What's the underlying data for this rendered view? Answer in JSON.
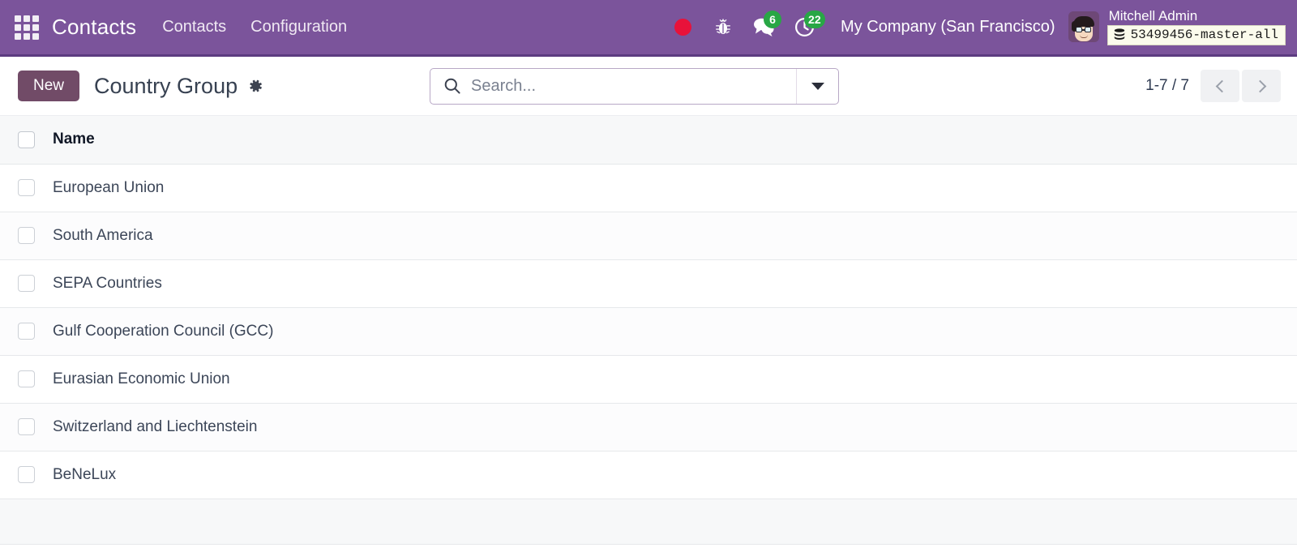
{
  "navbar": {
    "apps_icon": "apps-grid-icon",
    "brand": "Contacts",
    "menu_items": [
      {
        "label": "Contacts"
      },
      {
        "label": "Configuration"
      }
    ],
    "recording_indicator": "record-dot-icon",
    "debug_icon": "bug-icon",
    "messages": {
      "icon": "chat-icon",
      "count": "6"
    },
    "activities": {
      "icon": "clock-icon",
      "count": "22"
    },
    "company": "My Company (San Francisco)",
    "user": {
      "avatar": "user-avatar",
      "name": "Mitchell Admin",
      "database": "53499456-master-all",
      "database_icon": "database-icon"
    },
    "colors": {
      "background": "#7b549b",
      "border": "#5c3b80",
      "badge_green": "#28a745",
      "record_red": "#e8123a"
    }
  },
  "control_panel": {
    "new_button": "New",
    "breadcrumb_title": "Country Group",
    "settings_icon": "gear-icon",
    "search": {
      "icon": "search-icon",
      "value": "",
      "placeholder": "Search...",
      "toggle_icon": "chevron-down-icon"
    },
    "pager": {
      "range": "1-7 / 7",
      "previous_icon": "chevron-left-icon",
      "next_icon": "chevron-right-icon"
    },
    "colors": {
      "new_button": "#714b67"
    }
  },
  "list": {
    "select_all_checkbox": "select-all",
    "columns": [
      "Name"
    ],
    "rows": [
      {
        "name": "European Union"
      },
      {
        "name": "South America"
      },
      {
        "name": "SEPA Countries"
      },
      {
        "name": "Gulf Cooperation Council (GCC)"
      },
      {
        "name": "Eurasian Economic Union"
      },
      {
        "name": "Switzerland and Liechtenstein"
      },
      {
        "name": "BeNeLux"
      }
    ]
  }
}
